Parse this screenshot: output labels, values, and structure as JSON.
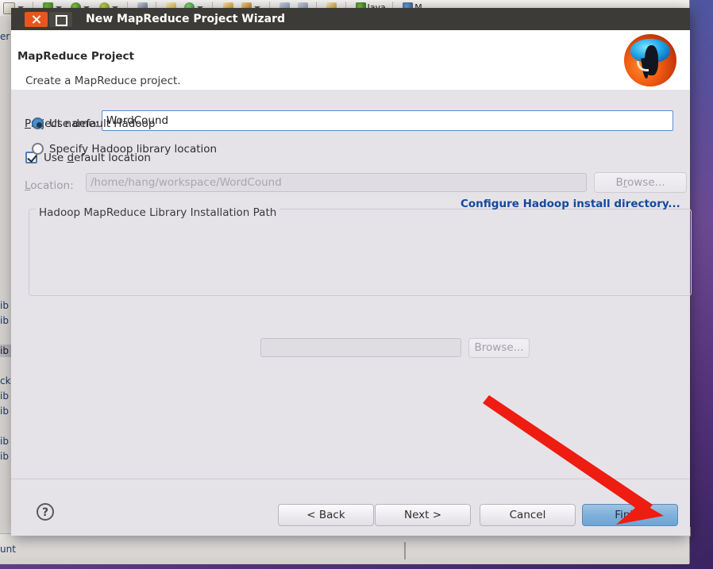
{
  "desktop": {
    "eclipse": {
      "perspective_java": "Java",
      "perspective_other": "M",
      "status_text": "unt",
      "tree_items": [
        "er",
        "ib",
        "ib",
        "ib",
        "cka",
        "ib",
        "ib",
        "ib",
        "ib"
      ]
    }
  },
  "dialog": {
    "titlebar": {
      "title": "New MapReduce Project Wizard",
      "close_icon": "close-icon",
      "maximize_icon": "maximize-icon"
    },
    "header": {
      "title": "MapReduce Project",
      "subtitle": "Create a MapReduce project.",
      "logo_icon": "hadoop-elephant-logo"
    },
    "form": {
      "project_name_label": "Project name:",
      "project_name_value": "WordCound",
      "project_name_placeholder": "",
      "use_default_location_label": "Use default location",
      "use_default_location_checked": true,
      "location_label": "Location:",
      "location_value": "/home/hang/workspace/WordCound",
      "location_browse_label": "Browse...",
      "location_browse_enabled": false
    },
    "hadoop_group": {
      "title": "Hadoop MapReduce Library Installation Path",
      "use_default_label": "Use default Hadoop",
      "use_default_selected": true,
      "specify_label": "Specify Hadoop library location",
      "specify_selected": false,
      "specify_path_value": "",
      "specify_browse_label": "Browse...",
      "specify_browse_enabled": false,
      "configure_link_label": "Configure Hadoop install directory...",
      "configure_link_color": "#14489c"
    },
    "footer": {
      "help_label": "?",
      "back_label": "< Back",
      "next_label": "Next >",
      "cancel_label": "Cancel",
      "finish_label": "Finish",
      "finish_is_default": true,
      "finish_color": "#7fb0da"
    }
  },
  "annotation": {
    "arrow_color": "#ee1c11",
    "arrow_from": "618,500",
    "arrow_to": "828,642",
    "points_at": "finish-button"
  }
}
